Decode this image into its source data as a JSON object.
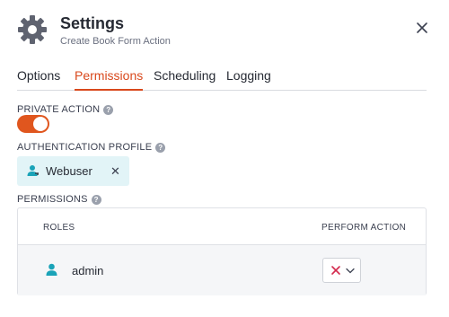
{
  "header": {
    "title": "Settings",
    "subtitle": "Create Book Form Action"
  },
  "tabs": [
    {
      "label": "Options",
      "active": false
    },
    {
      "label": "Permissions",
      "active": true
    },
    {
      "label": "Scheduling",
      "active": false
    },
    {
      "label": "Logging",
      "active": false
    }
  ],
  "private_action": {
    "label": "PRIVATE ACTION",
    "enabled": true
  },
  "authentication_profile": {
    "label": "AUTHENTICATION PROFILE",
    "value": "Webuser"
  },
  "permissions": {
    "label": "PERMISSIONS",
    "columns": [
      "ROLES",
      "PERFORM ACTION"
    ],
    "rows": [
      {
        "role": "admin",
        "perform_action": "denied"
      }
    ]
  },
  "colors": {
    "accent": "#d9481c",
    "toggle_on": "#e0561e",
    "chip_bg": "#e2f4f7",
    "user_icon": "#1aa3b8",
    "deny_x": "#d42a4e"
  },
  "icons": {
    "header": "gear-icon",
    "close": "close-icon",
    "help": "help-icon",
    "user": "user-icon",
    "deny": "x-icon",
    "dropdown": "chevron-down-icon"
  }
}
